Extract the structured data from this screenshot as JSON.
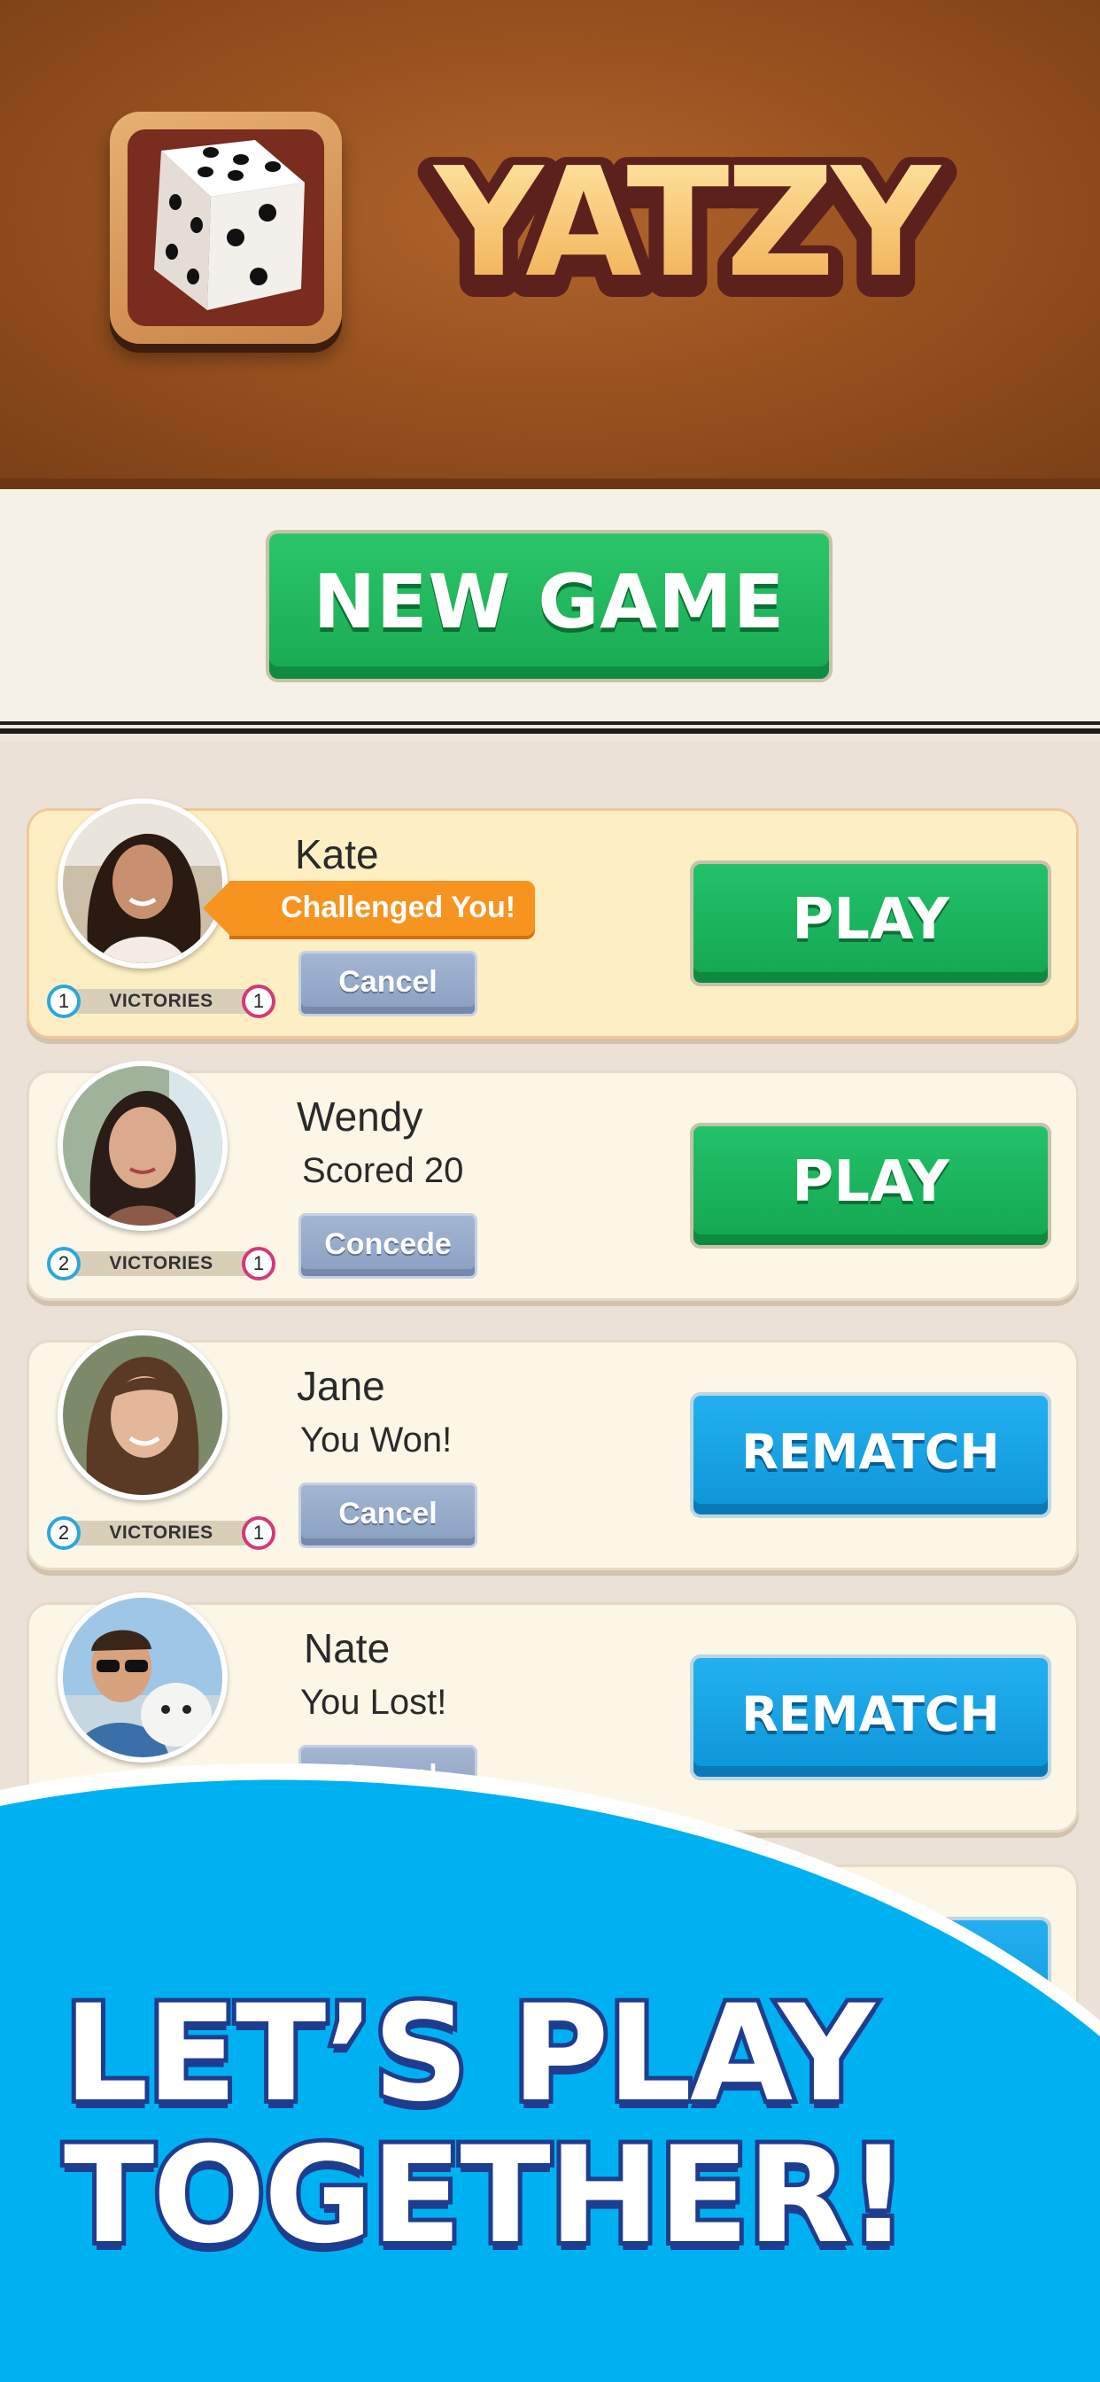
{
  "app": {
    "title": "YATZY"
  },
  "primary_action": {
    "label": "NEW GAME"
  },
  "games": [
    {
      "name": "Kate",
      "status": "",
      "badge": "Challenged You!",
      "victories_label": "VICTORIES",
      "my_wins": "1",
      "their_wins": "1",
      "secondary_label": "Cancel",
      "action_label": "PLAY",
      "action_type": "play"
    },
    {
      "name": "Wendy",
      "status": "Scored 20",
      "badge": "",
      "victories_label": "VICTORIES",
      "my_wins": "2",
      "their_wins": "1",
      "secondary_label": "Concede",
      "action_label": "PLAY",
      "action_type": "play"
    },
    {
      "name": "Jane",
      "status": "You Won!",
      "badge": "",
      "victories_label": "VICTORIES",
      "my_wins": "2",
      "their_wins": "1",
      "secondary_label": "Cancel",
      "action_label": "REMATCH",
      "action_type": "rematch"
    },
    {
      "name": "Nate",
      "status": "You Lost!",
      "badge": "",
      "victories_label": "VICTORIES",
      "my_wins": "",
      "their_wins": "",
      "secondary_label": "Cancel",
      "action_label": "REMATCH",
      "action_type": "rematch"
    }
  ],
  "banner": {
    "line1": "LET’S PLAY",
    "line2": "TOGETHER!"
  },
  "colors": {
    "header_wood": "#9a5320",
    "play_green": "#18a952",
    "rematch_blue": "#0c95d9",
    "banner_blue": "#00b1f2",
    "challenge_orange": "#f7941f"
  }
}
